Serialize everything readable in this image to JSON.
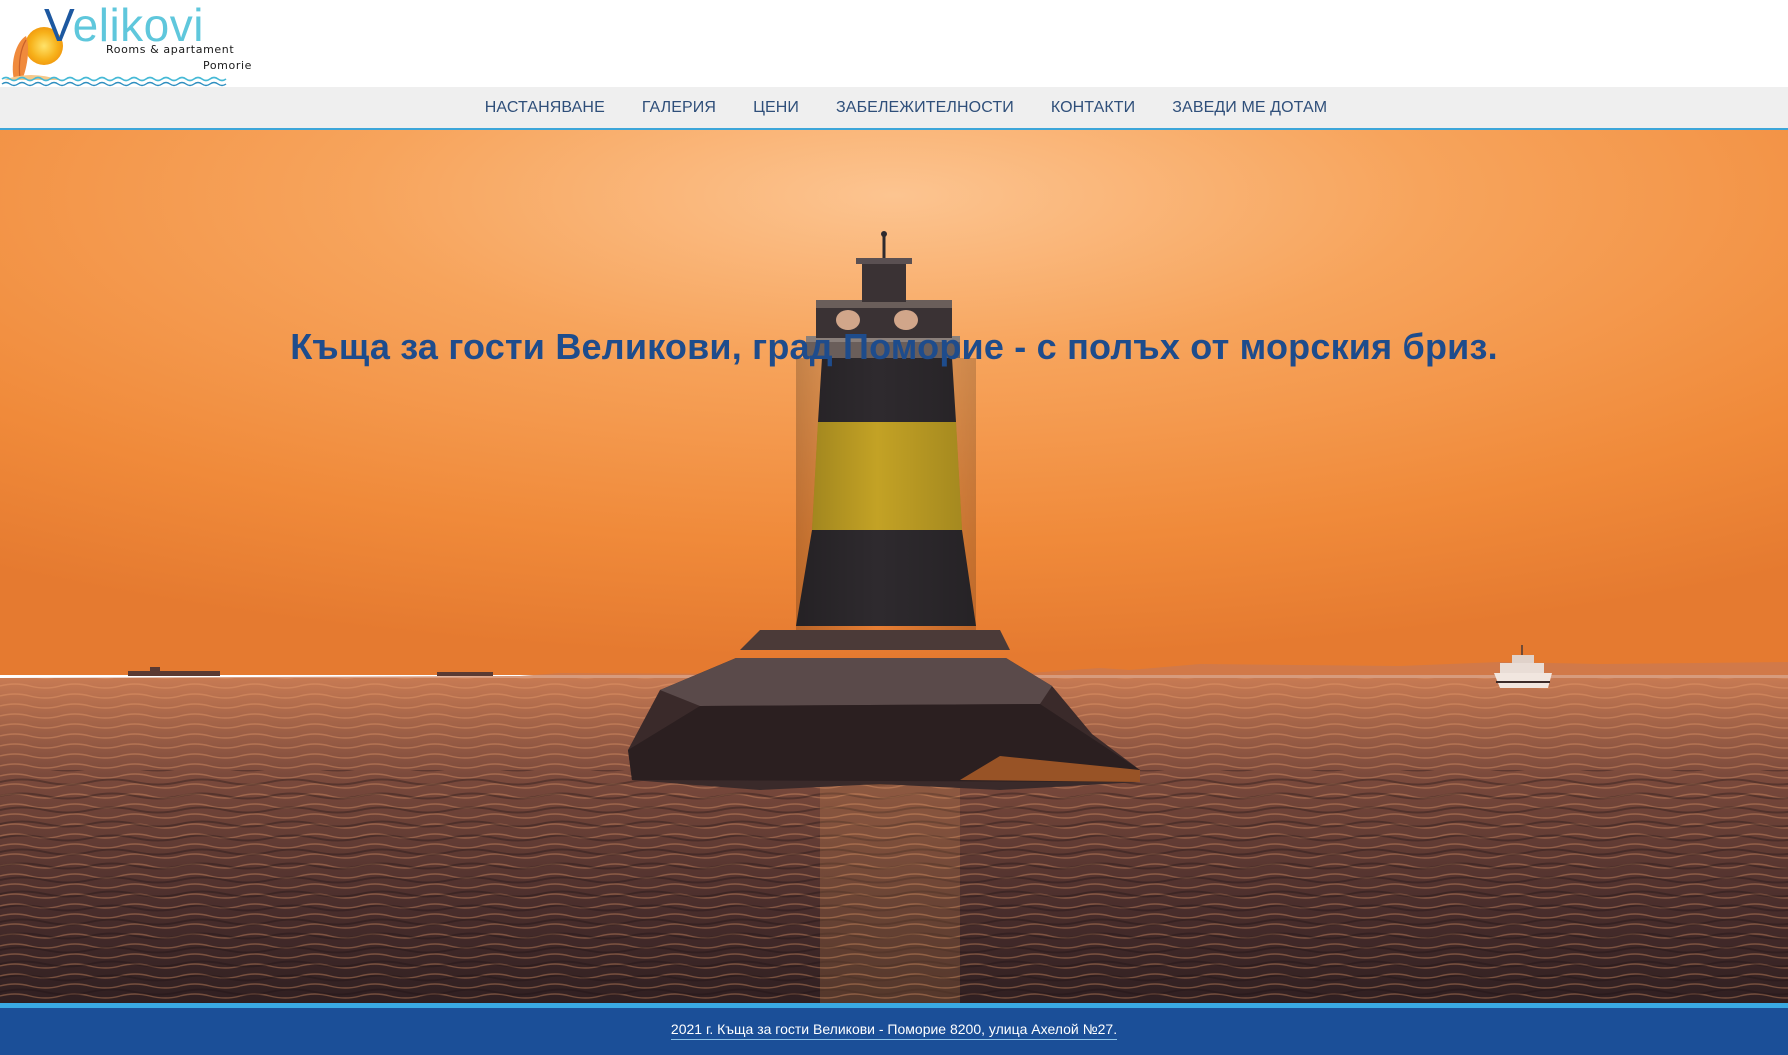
{
  "logo": {
    "word_initial": "V",
    "word_rest": "elikovi",
    "subtitle": "Rooms & apartament",
    "city": "Pomorie",
    "colors": {
      "primary": "#1d58a0",
      "secondary": "#5fc7dc",
      "sun": "#f7b21b"
    }
  },
  "nav": {
    "items": [
      {
        "label": "НАСТАНЯВАНЕ"
      },
      {
        "label": "ГАЛЕРИЯ"
      },
      {
        "label": "ЦЕНИ"
      },
      {
        "label": "ЗАБЕЛЕЖИТЕЛНОСТИ"
      },
      {
        "label": "КОНТАКТИ"
      },
      {
        "label": "ЗАВЕДИ МЕ ДОТАМ"
      }
    ]
  },
  "hero": {
    "title": "Къща за гости Великови, град Поморие - с полъх от морския бриз.",
    "image": "lighthouse-sunset-sea"
  },
  "footer": {
    "text": "2021 г. Къща за гости Великови - Поморие 8200, улица Ахелой №27."
  },
  "colors": {
    "nav_background": "#efefef",
    "nav_accent": "#3da6d9",
    "title_color": "#1e4c8c",
    "footer_background": "#1b4f98",
    "footer_accent": "#3aaae3"
  }
}
